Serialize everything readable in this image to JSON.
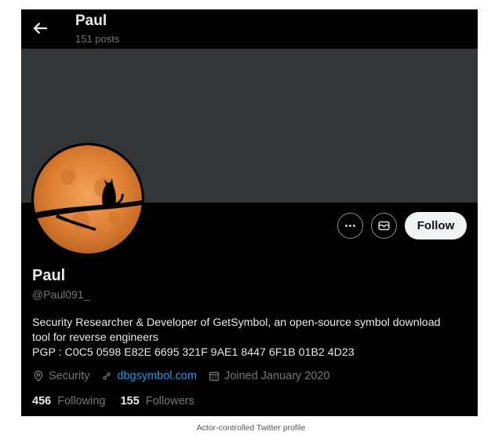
{
  "header": {
    "name": "Paul",
    "posts": "151 posts"
  },
  "profile": {
    "name": "Paul",
    "handle": "@Paul091_",
    "bio_lines": [
      "Security Researcher & Developer of GetSymbol, an open-source symbol download",
      "tool for reverse engineers",
      "PGP : C0C5 0598 E82E 6695 321F 9AE1 8447 6F1B 01B2 4D23"
    ],
    "category": "Security",
    "website": "dbgsymbol.com",
    "joined": "Joined January 2020",
    "following_count": "456",
    "following_label": "Following",
    "followers_count": "155",
    "followers_label": "Followers"
  },
  "actions": {
    "follow_label": "Follow"
  },
  "caption": "Actor-controlled Twitter profile",
  "icons": [
    "back-arrow-icon",
    "more-icon",
    "message-icon",
    "location-icon",
    "link-icon",
    "calendar-icon"
  ],
  "colors": {
    "accent": "#1d9bf0",
    "background": "#000000",
    "banner": "#333639",
    "muted": "#71767b"
  }
}
